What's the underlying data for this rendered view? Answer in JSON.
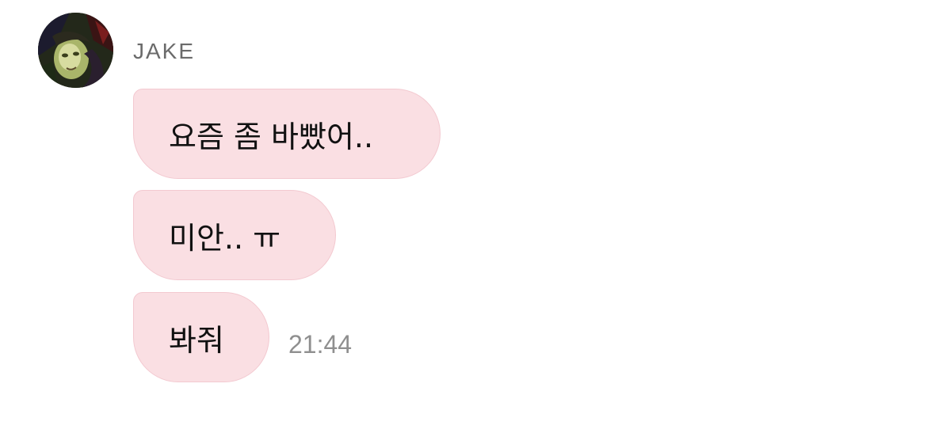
{
  "sender": {
    "name": "JAKE",
    "avatar_icon": "profile-photo-icon"
  },
  "messages": [
    {
      "text": "요즘 좀 바빴어.."
    },
    {
      "text": "미안.. ㅠ"
    },
    {
      "text": "봐줘"
    }
  ],
  "timestamp": "21:44",
  "colors": {
    "bubble_background": "#fadfe3",
    "bubble_border": "#f3c9d0",
    "sender_name": "#6b6b6b",
    "timestamp": "#8f8f8f",
    "message_text": "#111111"
  }
}
